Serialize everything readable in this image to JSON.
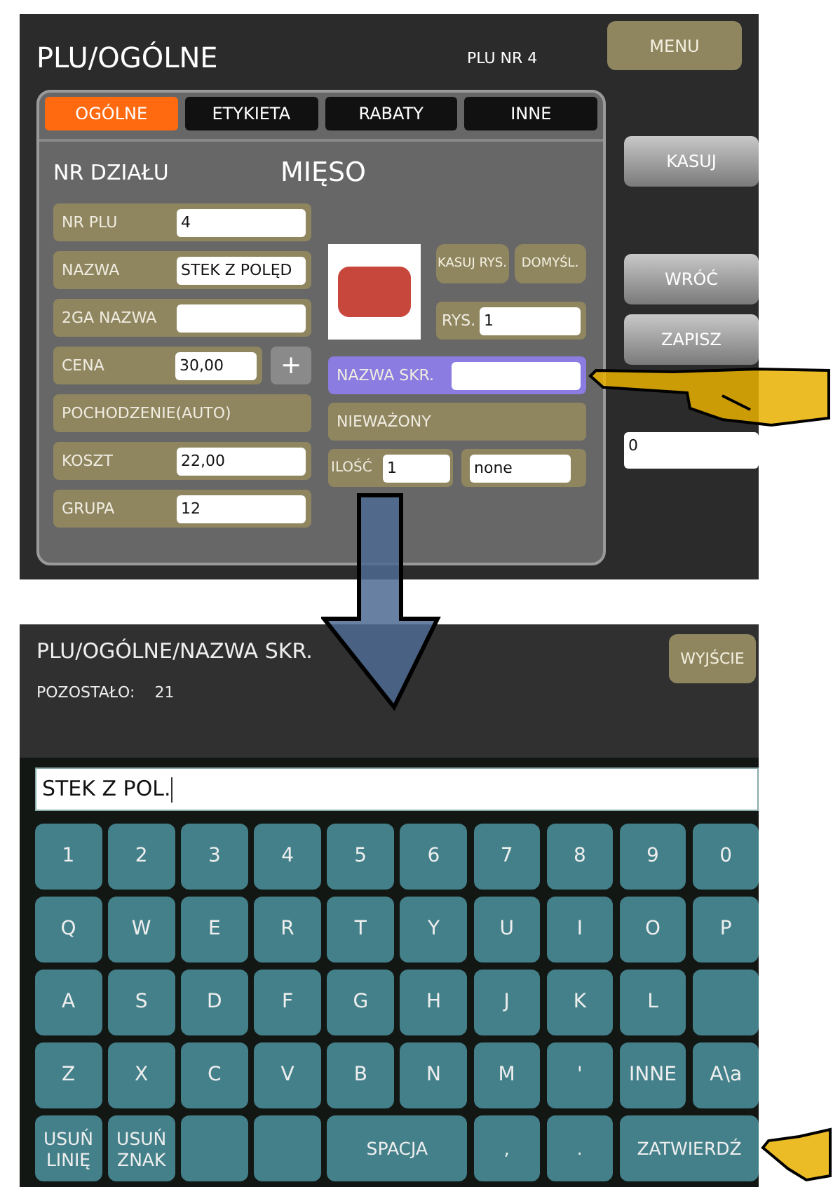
{
  "top_screen": {
    "title": "PLU/OGÓLNE",
    "plu_label": "PLU NR 4",
    "menu_button": "MENU",
    "tabs": [
      {
        "label": "OGÓLNE",
        "selected": true
      },
      {
        "label": "ETYKIETA",
        "selected": false
      },
      {
        "label": "RABATY",
        "selected": false
      },
      {
        "label": "INNE",
        "selected": false
      }
    ],
    "department_label": "NR DZIAŁU",
    "department_value": "MIĘSO",
    "left_fields": [
      {
        "kind": "input",
        "label": "NR PLU",
        "value": "4"
      },
      {
        "kind": "input",
        "label": "NAZWA",
        "value": "STEK Z POLĘD"
      },
      {
        "kind": "input",
        "label": "2GA NAZWA"
      },
      {
        "kind": "input_plus",
        "label": "CENA",
        "value": "30,00",
        "button": "+"
      },
      {
        "kind": "label",
        "label": "POCHODZENIE(AUTO)"
      },
      {
        "kind": "input",
        "label": "KOSZT",
        "value": "22,00"
      },
      {
        "kind": "input",
        "label": "GRUPA",
        "value": "12"
      }
    ],
    "image_buttons": [
      "KASUJ RYS.",
      "DOMYŚL."
    ],
    "image_field": {
      "label": "RYS.",
      "value": "1"
    },
    "short_name": {
      "label": "NAZWA SKR.",
      "selected": true
    },
    "weight_option": "NIEWAŻONY",
    "quantity": {
      "label": "ILOŚĆ",
      "value": "1"
    },
    "unit_value": "none",
    "side_buttons": [
      "KASUJ",
      "WRÓĆ",
      "ZAPISZ"
    ],
    "side_field": "0"
  },
  "bottom_screen": {
    "title": "PLU/OGÓLNE/NAZWA SKR.",
    "remaining_label": "POZOSTAŁO:",
    "remaining_value": "21",
    "exit_button": "WYJŚCIE",
    "input_value": "STEK Z POL.",
    "keys": [
      [
        {
          "label": "1",
          "wide": false
        },
        {
          "label": "2",
          "wide": false
        },
        {
          "label": "3",
          "wide": false
        },
        {
          "label": "4",
          "wide": false
        },
        {
          "label": "5",
          "wide": false
        },
        {
          "label": "6",
          "wide": false
        },
        {
          "label": "7",
          "wide": false
        },
        {
          "label": "8",
          "wide": false
        },
        {
          "label": "9",
          "wide": false
        },
        {
          "label": "0",
          "wide": false
        }
      ],
      [
        {
          "label": "Q",
          "wide": false
        },
        {
          "label": "W",
          "wide": false
        },
        {
          "label": "E",
          "wide": false
        },
        {
          "label": "R",
          "wide": false
        },
        {
          "label": "T",
          "wide": false
        },
        {
          "label": "Y",
          "wide": false
        },
        {
          "label": "U",
          "wide": false
        },
        {
          "label": "I",
          "wide": false
        },
        {
          "label": "O",
          "wide": false
        },
        {
          "label": "P",
          "wide": false
        }
      ],
      [
        {
          "label": "A",
          "wide": false
        },
        {
          "label": "S",
          "wide": false
        },
        {
          "label": "D",
          "wide": false
        },
        {
          "label": "F",
          "wide": false
        },
        {
          "label": "G",
          "wide": false
        },
        {
          "label": "H",
          "wide": false
        },
        {
          "label": "J",
          "wide": false
        },
        {
          "label": "K",
          "wide": false
        },
        {
          "label": "L",
          "wide": false
        },
        {
          "wide": false
        }
      ],
      [
        {
          "label": "Z",
          "wide": false
        },
        {
          "label": "X",
          "wide": false
        },
        {
          "label": "C",
          "wide": false
        },
        {
          "label": "V",
          "wide": false
        },
        {
          "label": "B",
          "wide": false
        },
        {
          "label": "N",
          "wide": false
        },
        {
          "label": "M",
          "wide": false
        },
        {
          "label": "'",
          "wide": false
        },
        {
          "label": "INNE",
          "wide": false
        },
        {
          "label": "A\\a",
          "wide": false
        }
      ],
      [
        {
          "label": "USUŃ LINIĘ",
          "wide": false
        },
        {
          "label": "USUŃ ZNAK",
          "wide": false
        },
        {
          "wide": false
        },
        {
          "wide": false
        },
        {
          "label": "SPACJA",
          "wide": true
        },
        {
          "label": ",",
          "wide": false
        },
        {
          "label": ".",
          "wide": false
        },
        {
          "label": "ZATWIERDŹ",
          "wide": true
        }
      ]
    ]
  }
}
